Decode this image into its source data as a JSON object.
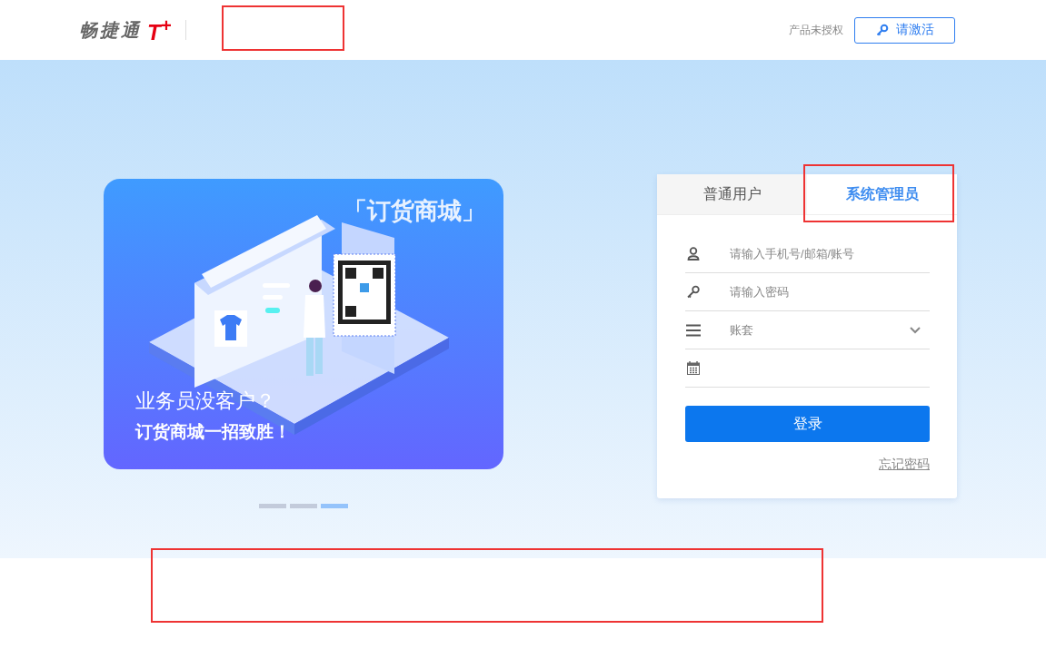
{
  "header": {
    "logo": {
      "name": "畅捷通",
      "mark": "T$^{+}$"
    },
    "license_status": "产品未授权",
    "activate_button": "请激活"
  },
  "banner": {
    "tag": "「订货商城」",
    "headline": "业务员没客户？",
    "subline": "订货商城一招致胜！"
  },
  "carousel": [
    {
      "selected": false
    },
    {
      "selected": false
    },
    {
      "selected": true
    }
  ],
  "login": {
    "tabs": [
      {
        "label": "普通用户",
        "selected": false
      },
      {
        "label": "系统管理员",
        "selected": true
      }
    ],
    "fields": [
      {
        "kind": "account",
        "placeholder": "请输入手机号/邮箱/账号"
      },
      {
        "kind": "password",
        "placeholder": "请输入密码"
      },
      {
        "kind": "select",
        "placeholder": "账套"
      },
      {
        "kind": "date"
      }
    ],
    "submit": "登录",
    "forgot_link": "忘记密码"
  }
}
